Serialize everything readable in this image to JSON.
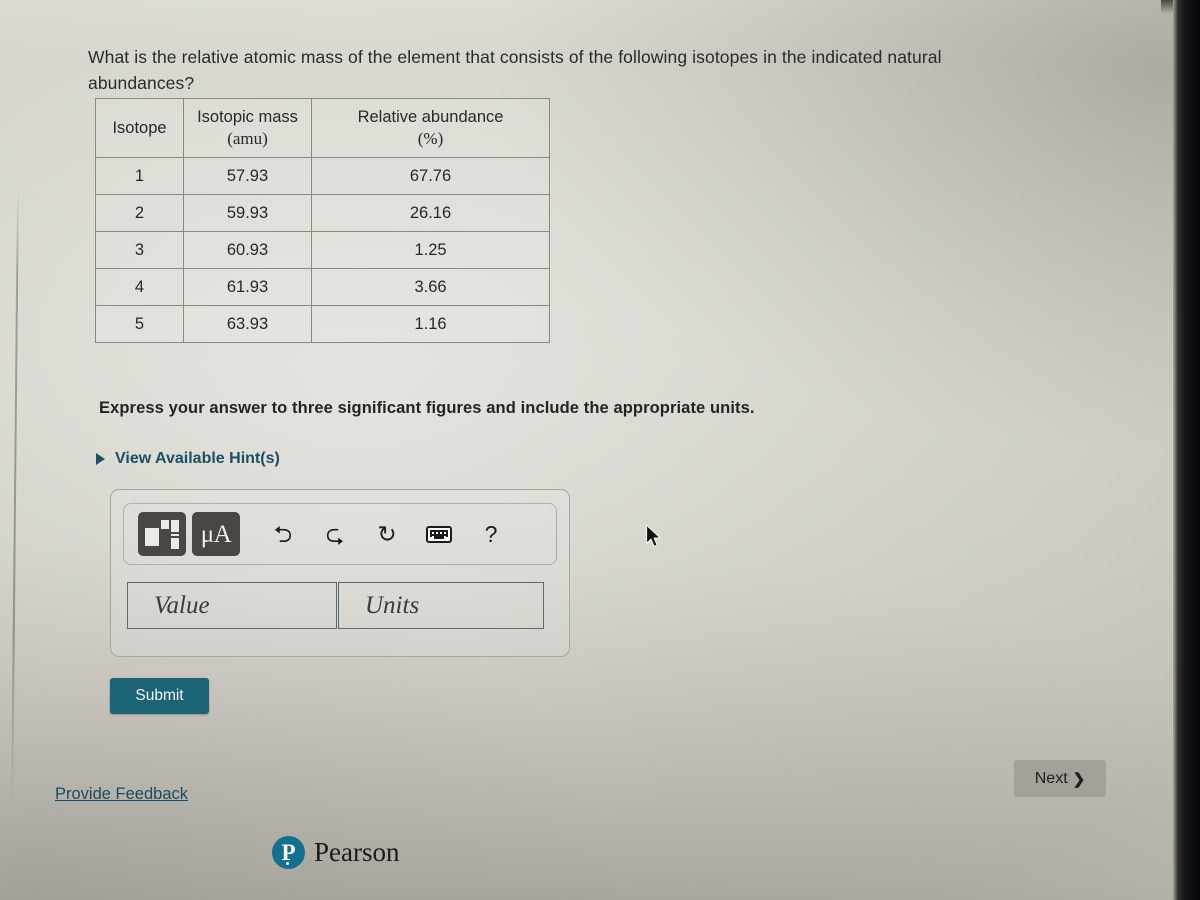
{
  "question": {
    "prompt": "What is the relative atomic mass of the element that consists of the following isotopes in the indicated natural abundances?"
  },
  "isotope_table": {
    "headers": {
      "isotope": "Isotope",
      "mass_main": "Isotopic mass",
      "mass_unit": "(amu)",
      "abundance_main": "Relative abundance",
      "abundance_unit": "(%)"
    },
    "rows": [
      {
        "isotope": "1",
        "mass": "57.93",
        "abundance": "67.76"
      },
      {
        "isotope": "2",
        "mass": "59.93",
        "abundance": "26.16"
      },
      {
        "isotope": "3",
        "mass": "60.93",
        "abundance": "1.25"
      },
      {
        "isotope": "4",
        "mass": "61.93",
        "abundance": "3.66"
      },
      {
        "isotope": "5",
        "mass": "63.93",
        "abundance": "1.16"
      }
    ]
  },
  "instructions": {
    "express_answer": "Express your answer to three significant figures and include the appropriate units."
  },
  "hints": {
    "label": "View Available Hint(s)",
    "caret_icon": "triangle-right-icon",
    "accent_color": "#1d4f63"
  },
  "answer_panel": {
    "toolbar": {
      "items": [
        {
          "name": "template-icon",
          "label": ""
        },
        {
          "name": "units-icon",
          "label": "μÅ"
        },
        {
          "name": "undo-icon",
          "label": "↶"
        },
        {
          "name": "redo-icon",
          "label": "↷"
        },
        {
          "name": "reset-icon",
          "label": "↻"
        },
        {
          "name": "keyboard-icon",
          "label": ""
        },
        {
          "name": "help-icon",
          "label": "?"
        }
      ],
      "units_label": "μA",
      "undo_glyph": "⮌",
      "redo_glyph": "⮎",
      "reset_glyph": "↻",
      "help_glyph": "?"
    },
    "value_input": {
      "value": "",
      "placeholder": "Value"
    },
    "units_input": {
      "value": "",
      "placeholder": "Units"
    }
  },
  "actions": {
    "submit_label": "Submit",
    "submit_color": "#1c6378",
    "next_label": "Next",
    "next_chevron": "❯",
    "next_color": "#a3a199"
  },
  "footer": {
    "provide_feedback": "Provide Feedback",
    "brand_mark_letter": "P",
    "brand_name": "Pearson",
    "brand_color": "#16708d"
  }
}
